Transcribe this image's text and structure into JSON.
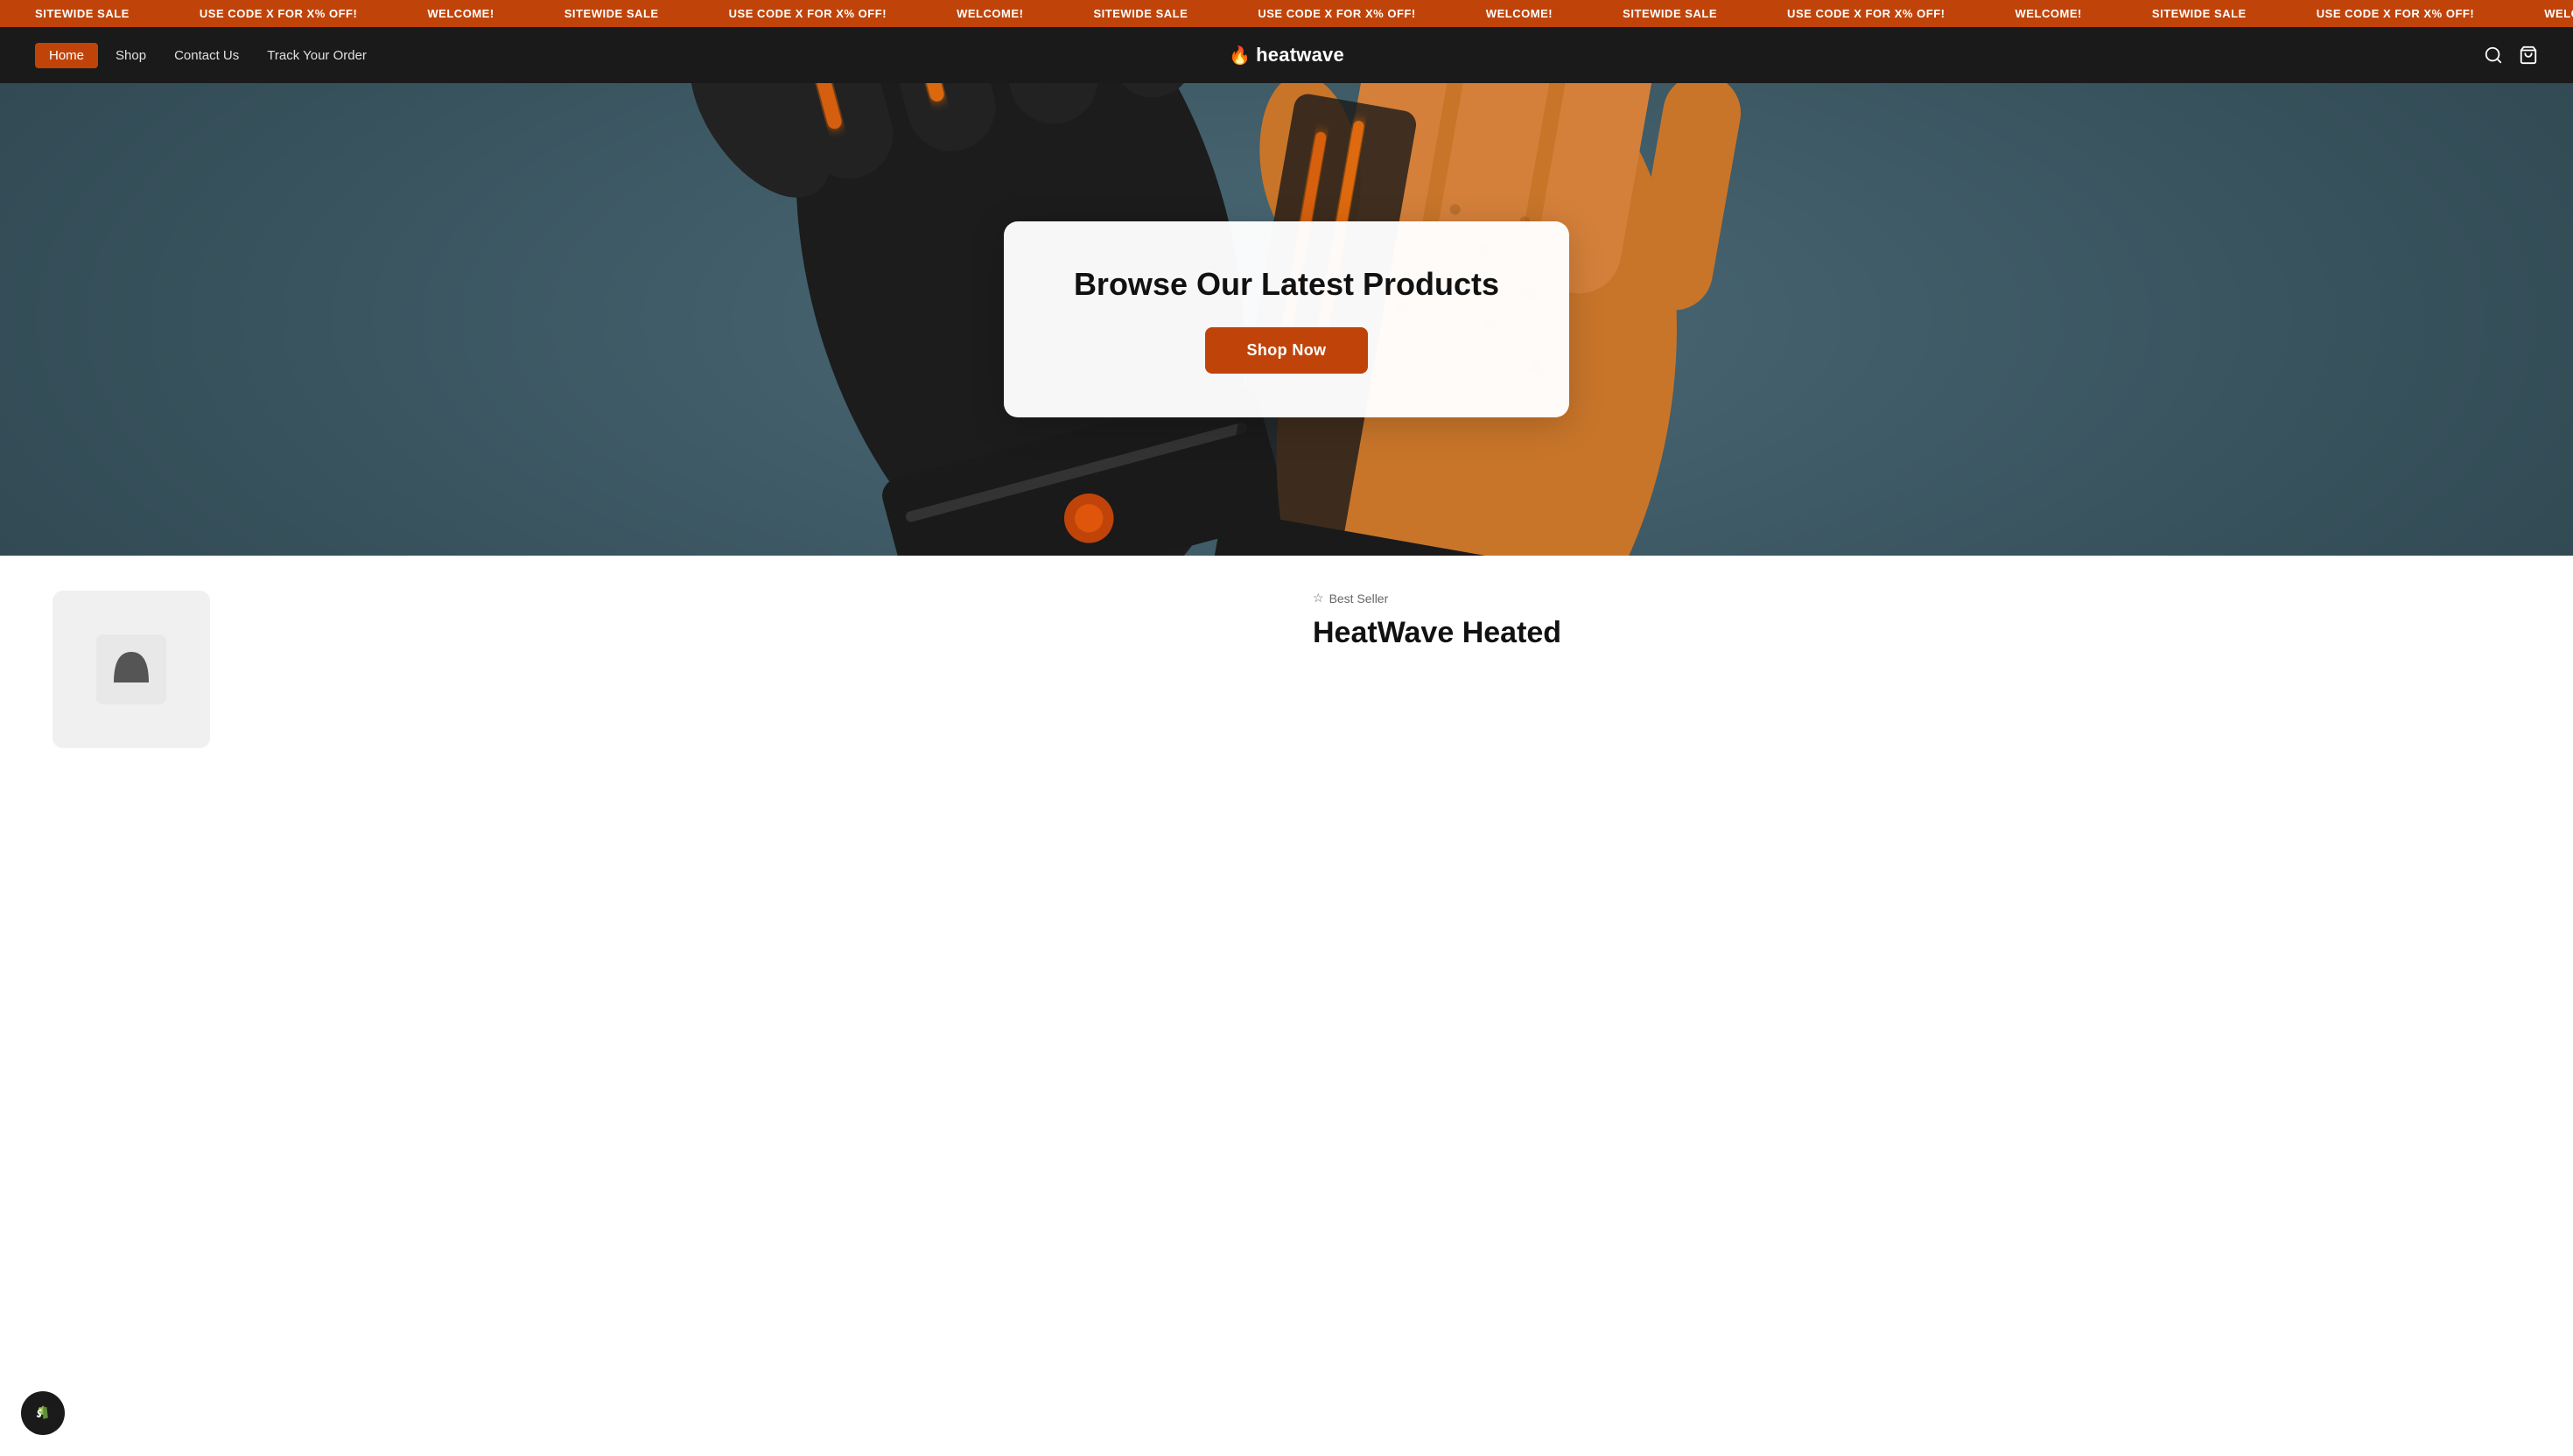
{
  "announcement": {
    "items": [
      "SITEWIDE SALE",
      "USE CODE X FOR X% OFF!",
      "WELCOME!",
      "SITEWIDE SALE",
      "USE CODE X FOR X% OFF!",
      "WELCOME!",
      "SITEWIDE SALE",
      "USE CODE X FOR X% OFF!",
      "WELCOME!"
    ]
  },
  "nav": {
    "home_label": "Home",
    "shop_label": "Shop",
    "contact_label": "Contact Us",
    "track_label": "Track Your Order",
    "brand_name": "heatwave"
  },
  "hero": {
    "title": "Browse Our Latest Products",
    "shop_now_label": "Shop Now"
  },
  "below_hero": {
    "badge_label": "Best Seller",
    "product_title_partial": "HeatWave Heated"
  },
  "colors": {
    "accent": "#c0440a",
    "nav_bg": "#1a1a1a",
    "announcement_bg": "#c0440a"
  }
}
